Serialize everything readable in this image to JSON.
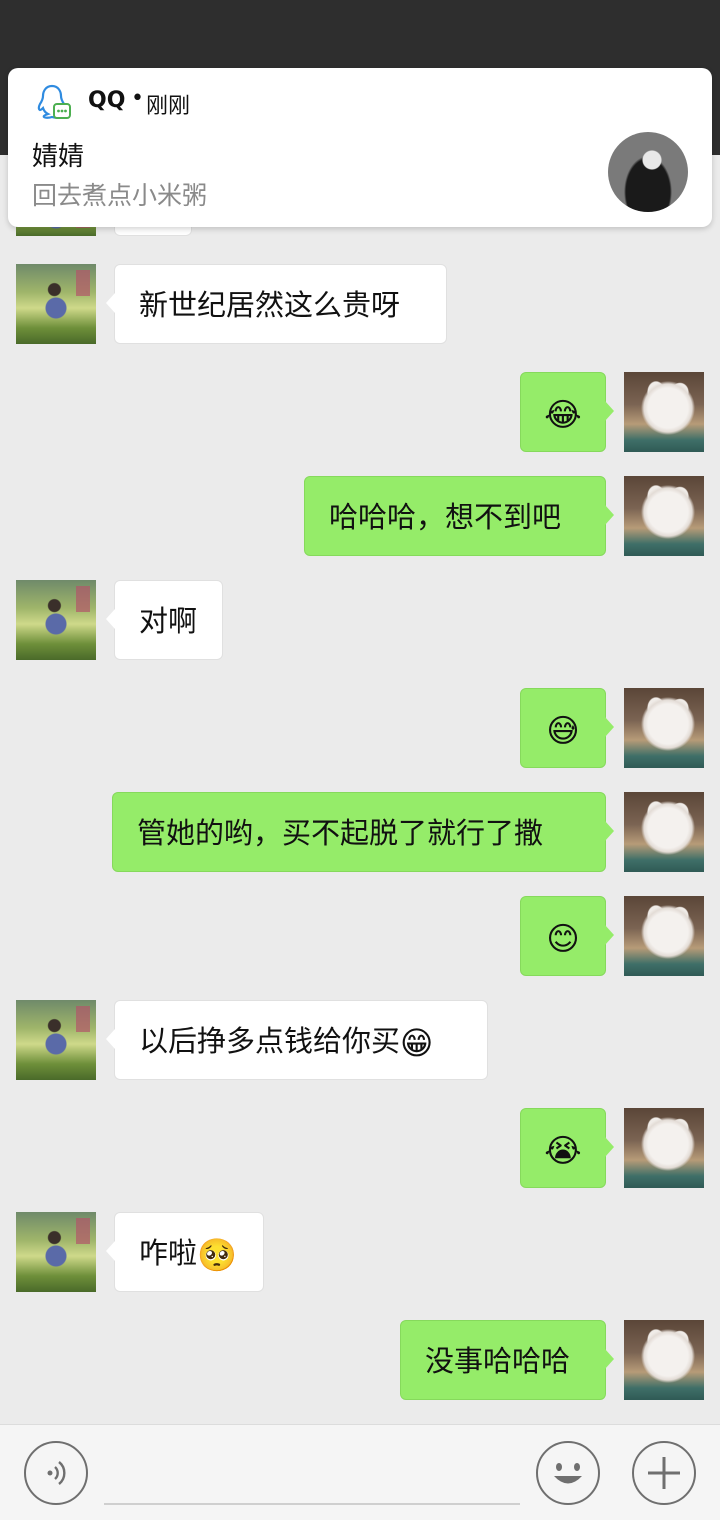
{
  "notification": {
    "app": "QQ",
    "separator": "•",
    "time": "刚刚",
    "title": "婧婧",
    "body": "回去煮点小米粥"
  },
  "messages": [
    {
      "side": "left",
      "text": "新世纪居然这么贵呀",
      "emoji": ""
    },
    {
      "side": "right",
      "text": "",
      "emoji": "😂"
    },
    {
      "side": "right",
      "text": "哈哈哈，想不到吧",
      "emoji": ""
    },
    {
      "side": "left",
      "text": "对啊",
      "emoji": ""
    },
    {
      "side": "right",
      "text": "",
      "emoji": "😅"
    },
    {
      "side": "right",
      "text": "管她的哟，买不起脱了就行了撒",
      "emoji": ""
    },
    {
      "side": "right",
      "text": "",
      "emoji": "😊"
    },
    {
      "side": "left",
      "text": "以后挣多点钱给你买",
      "emoji": "😁"
    },
    {
      "side": "right",
      "text": "",
      "emoji": "😭"
    },
    {
      "side": "left",
      "text": "咋啦",
      "emoji": "🥺"
    },
    {
      "side": "right",
      "text": "没事哈哈哈",
      "emoji": ""
    }
  ],
  "input_bar": {
    "voice_icon": "voice-icon",
    "emoji_icon": "smiley-icon",
    "plus_icon": "plus-icon",
    "input_value": ""
  },
  "colors": {
    "outgoing_bubble": "#95ec69",
    "incoming_bubble": "#ffffff",
    "chat_background": "#ebebeb"
  }
}
